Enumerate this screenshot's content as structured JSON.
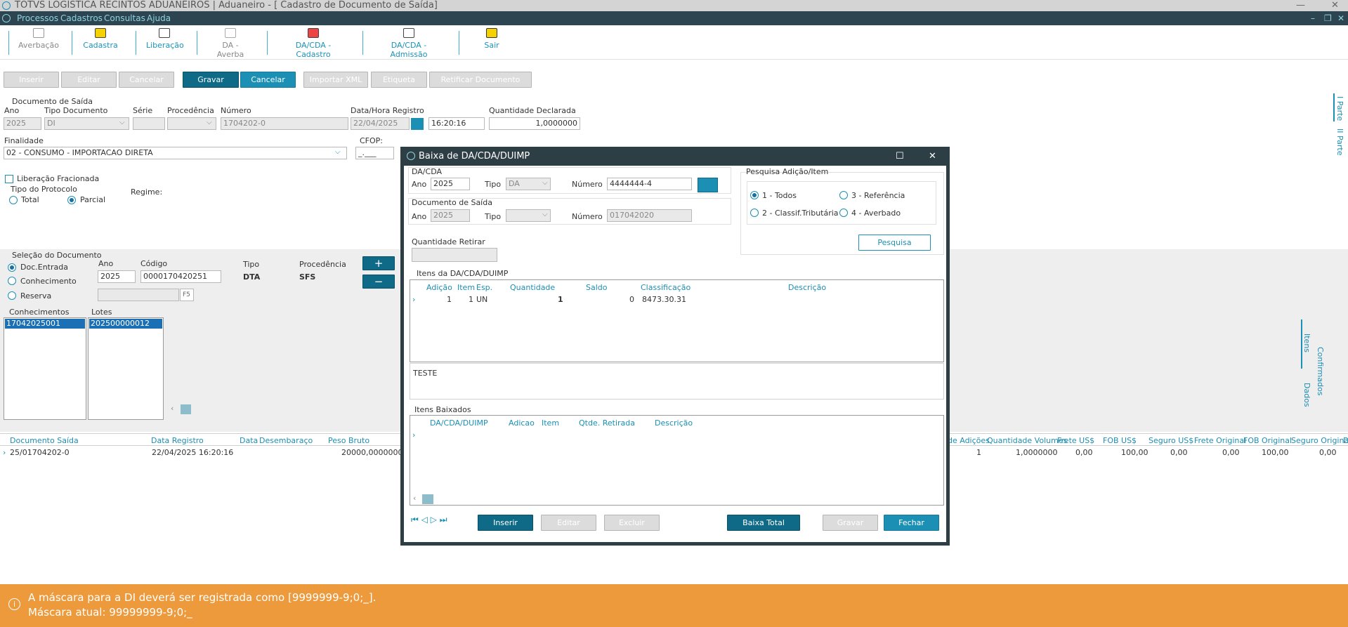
{
  "app_title": "TOTVS LOGÍSTICA RECINTOS ADUANEIROS | Aduaneiro - [ Cadastro de Documento de Saída]",
  "menu": [
    "Processos",
    "Cadastros",
    "Consultas",
    "Ajuda"
  ],
  "toolbar": {
    "averbacao": "Averbação",
    "cadastra": "Cadastra",
    "liberacao": "Liberação",
    "da_averba": "DA - Averba",
    "dacda_cadastro": "DA/CDA - Cadastro",
    "dacda_admissao": "DA/CDA - Admissão",
    "sair": "Sair"
  },
  "actions": {
    "inserir": "Inserir",
    "editar": "Editar",
    "cancelar1": "Cancelar",
    "gravar": "Gravar",
    "cancelar2": "Cancelar",
    "importar_xml": "Importar XML",
    "etiqueta": "Etiqueta",
    "retificar": "Retificar Documento"
  },
  "doc_saida": {
    "group_label": "Documento de Saída",
    "ano_label": "Ano",
    "ano": "2025",
    "tipo_label": "Tipo Documento",
    "tipo": "DI",
    "serie_label": "Série",
    "serie": "",
    "procedencia_label": "Procedência",
    "procedencia": "",
    "numero_label": "Número",
    "numero": "1704202-0",
    "data_label": "Data/Hora Registro",
    "data": "22/04/2025",
    "hora": "16:20:16",
    "qtd_label": "Quantidade Declarada",
    "qtd": "1,0000000",
    "finalidade_label": "Finalidade",
    "finalidade": "02 - CONSUMO - IMPORTACAO DIRETA",
    "cfop_label": "CFOP:",
    "cfop": "_.___",
    "lib_frac": "Liberação Fracionada",
    "tipo_protocolo": "Tipo do Protocolo",
    "total": "Total",
    "parcial": "Parcial",
    "regime": "Regime:"
  },
  "selecao": {
    "label": "Seleção do Documento",
    "doc_entrada": "Doc.Entrada",
    "conhecimento": "Conhecimento",
    "reserva": "Reserva",
    "ano_label": "Ano",
    "ano": "2025",
    "codigo_label": "Código",
    "codigo": "0000170420251",
    "tipo_label": "Tipo",
    "tipo": "DTA",
    "proc_label": "Procedência",
    "proc": "SFS",
    "f5": "F5",
    "conhecimentos_label": "Conhecimentos",
    "conhecimento_sel": "17042025001",
    "lotes_label": "Lotes",
    "lote_sel": "202500000012",
    "plus": "+",
    "minus": "−"
  },
  "side_tabs": {
    "parte1": "I Parte",
    "parte2": "II Parte",
    "itens": "Itens",
    "dados": "Dados",
    "confirmados": "Confirmados"
  },
  "bottom_grid": {
    "headers_left": [
      "Documento Saída",
      "Data Registro",
      "Data",
      "Desembaraço",
      "Peso Bruto"
    ],
    "row_left": [
      "25/01704202-0",
      "22/04/2025 16:20:16",
      "",
      "",
      "20000,0000000"
    ],
    "headers_right": [
      "de Adições",
      "Quantidade Volumes",
      "Frete US$",
      "FOB US$",
      "Seguro US$",
      "Frete Original",
      "FOB Original",
      "Seguro Original",
      "D"
    ],
    "row_right": [
      "1",
      "1,0000000",
      "0,00",
      "100,00",
      "0,00",
      "0,00",
      "100,00",
      "0,00",
      ""
    ]
  },
  "modal": {
    "title": "Baixa de DA/CDA/DUIMP",
    "dacda_label": "DA/CDA",
    "ano_label": "Ano",
    "ano": "2025",
    "tipo_label": "Tipo",
    "tipo": "DA",
    "numero_label": "Número",
    "numero": "4444444-4",
    "docsaida_label": "Documento de Saída",
    "ano2": "2025",
    "tipo2": "",
    "numero2": "017042020",
    "qtd_retirar_label": "Quantidade Retirar",
    "qtd_retirar": "",
    "pesquisa_label": "Pesquisa Adição/Item",
    "opt1": "1 - Todos",
    "opt2": "2 - Classif.Tributária",
    "opt3": "3 - Referência",
    "opt4": "4 - Averbado",
    "pesquisa_btn": "Pesquisa",
    "itens_label": "Itens da DA/CDA/DUIMP",
    "itens_headers": [
      "Adição",
      "Item",
      "Esp.",
      "Quantidade",
      "Saldo",
      "Classificação",
      "Descrição"
    ],
    "itens_row": [
      "1",
      "1",
      "UN",
      "1",
      "0",
      "8473.30.31",
      ""
    ],
    "memo": "TESTE",
    "baixados_label": "Itens Baixados",
    "baixados_headers": [
      "DA/CDA/DUIMP",
      "Adicao",
      "Item",
      "Qtde. Retirada",
      "Descrição"
    ],
    "btn_inserir": "Inserir",
    "btn_editar": "Editar",
    "btn_excluir": "Excluir",
    "btn_baixa_total": "Baixa Total",
    "btn_gravar": "Gravar",
    "btn_fechar": "Fechar"
  },
  "notification": {
    "line1": "A máscara para a DI deverá ser registrada como [9999999-9;0;_].",
    "line2": "Máscara atual: 99999999-9;0;_"
  },
  "colors": {
    "accent": "#1b8fb4",
    "menubar": "#2d4550",
    "notification": "#ec9a3c"
  }
}
